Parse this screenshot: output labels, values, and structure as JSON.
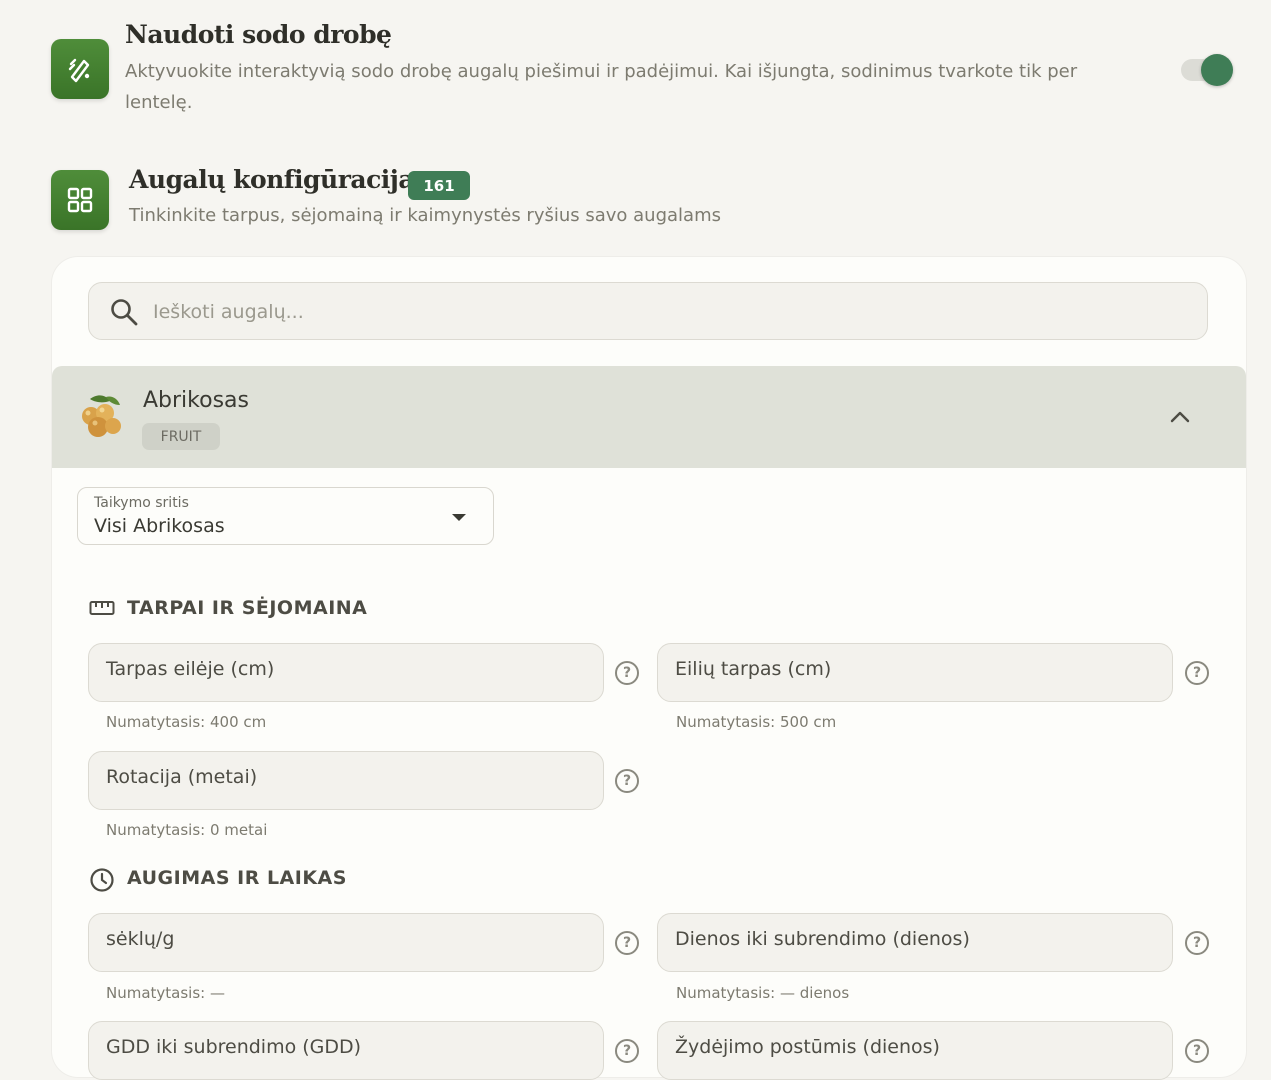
{
  "canvas": {
    "title": "Naudoti sodo drobę",
    "description_line1": "Aktyvuokite interaktyvią sodo drobę augalų piešimui ir padėjimui. Kai išjungta, sodinimus tvarkote tik per",
    "description_line2": "lentelę.",
    "toggle_on": true,
    "icon": "pencil-ruler-icon"
  },
  "plant_config": {
    "title": "Augalų konfigūracija",
    "count": "161",
    "subtitle": "Tinkinkite tarpus, sėjomainą ir kaimynystės ryšius savo augalams",
    "icon": "grid-icon"
  },
  "search": {
    "placeholder": "Ieškoti augalų..."
  },
  "plant": {
    "name": "Abrikosas",
    "category": "FRUIT",
    "icon": "apricot-icon",
    "expanded": true
  },
  "scope_select": {
    "label": "Taikymo sritis",
    "value": "Visi Abrikosas"
  },
  "sections": {
    "spacing": {
      "title": "TARPAI IR SĖJOMAINA",
      "icon": "ruler-icon",
      "fields": [
        {
          "label": "Tarpas eilėje (cm)",
          "hint": "Numatytasis: 400 cm"
        },
        {
          "label": "Eilių tarpas (cm)",
          "hint": "Numatytasis: 500 cm"
        },
        {
          "label": "Rotacija (metai)",
          "hint": "Numatytasis: 0 metai"
        }
      ]
    },
    "growth": {
      "title": "AUGIMAS IR LAIKAS",
      "icon": "clock-icon",
      "fields": [
        {
          "label": "sėklų/g",
          "hint": "Numatytasis: —"
        },
        {
          "label": "Dienos iki subrendimo (dienos)",
          "hint": "Numatytasis: — dienos"
        },
        {
          "label": "GDD iki subrendimo (GDD)",
          "hint": ""
        },
        {
          "label": "Žydėjimo postūmis (dienos)",
          "hint": ""
        }
      ]
    }
  },
  "colors": {
    "accent": "#3f7d56",
    "icon_tile": "#4a8636",
    "background": "#f6f5f1",
    "card": "#fdfdfa"
  }
}
